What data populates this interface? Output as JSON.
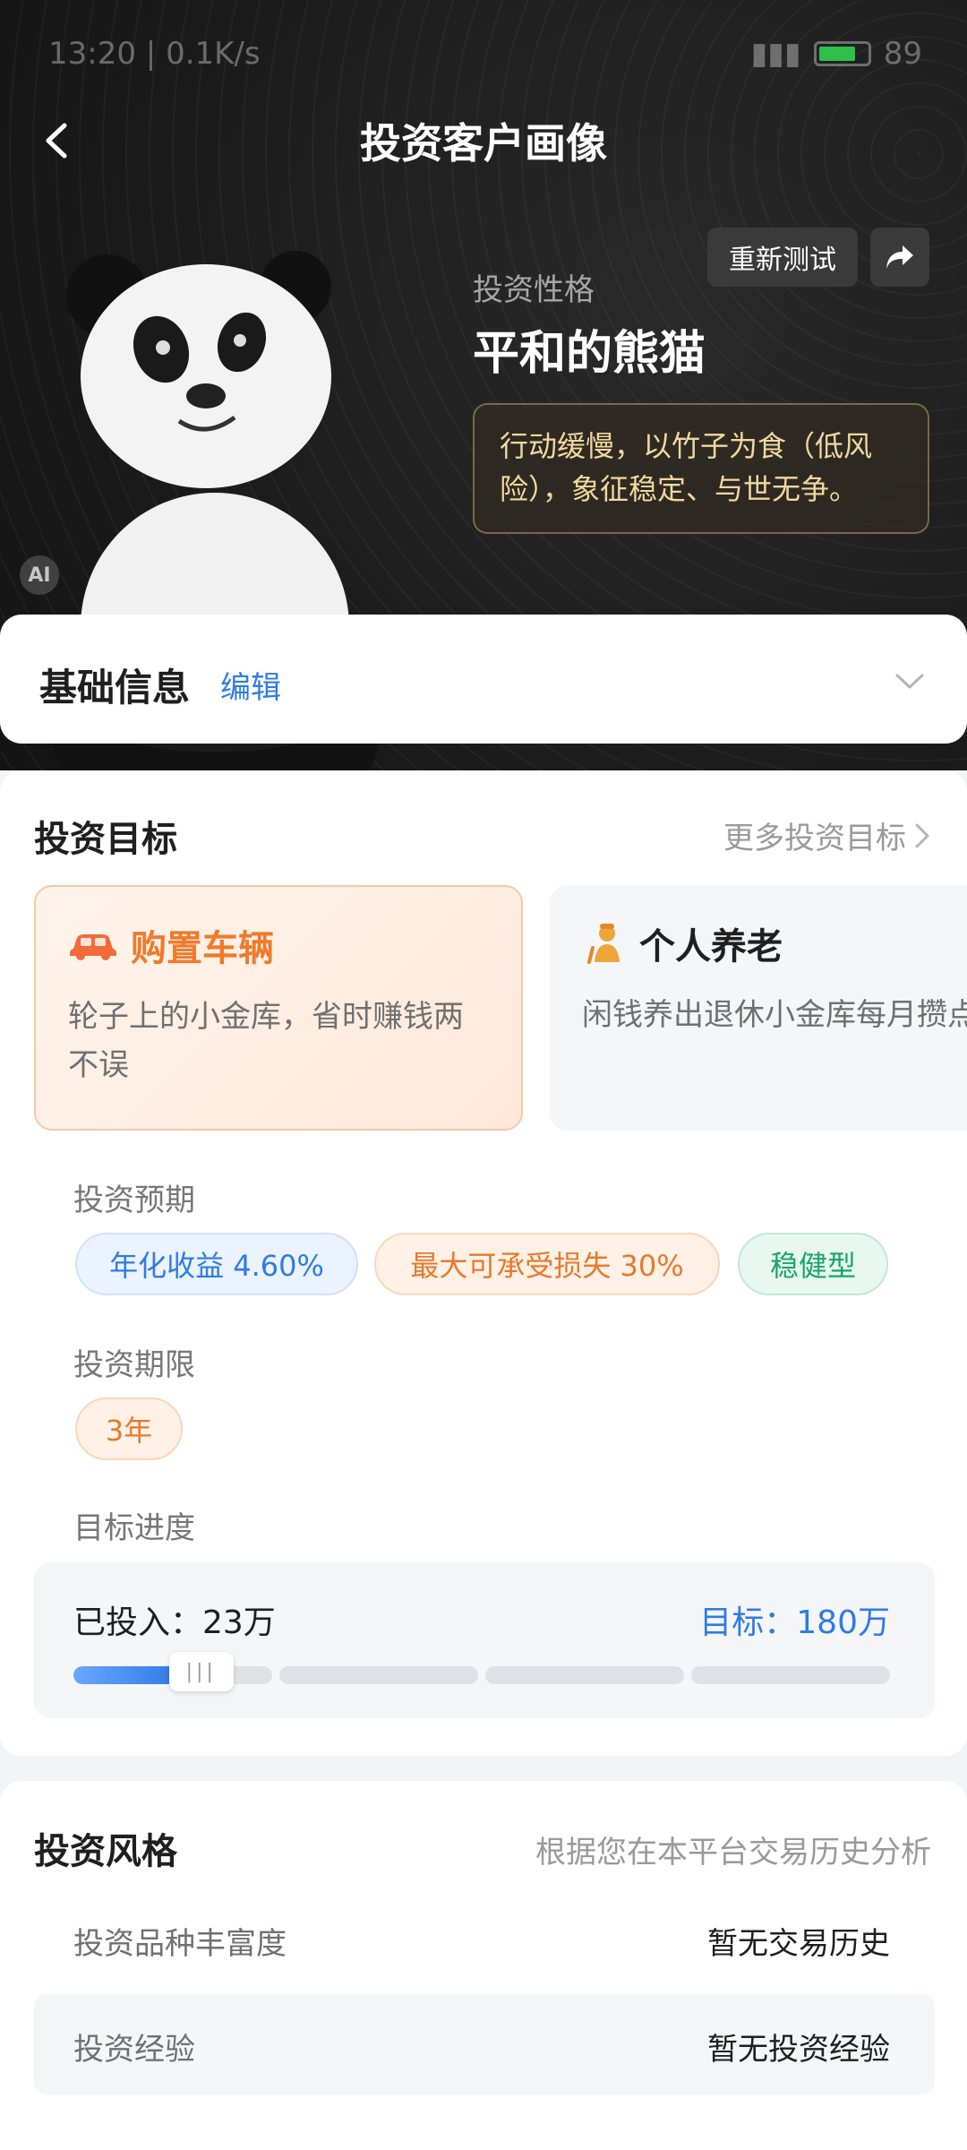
{
  "status_bar": {
    "time": "13:20",
    "speed": "0.1K/s",
    "battery": "89"
  },
  "header": {
    "title": "投资客户画像"
  },
  "hero": {
    "retest_label": "重新测试",
    "persona_label": "投资性格",
    "persona_name": "平和的熊猫",
    "persona_description": "行动缓慢，以竹子为食（低风险），象征稳定、与世无争。",
    "ai_badge": "AI"
  },
  "basic_info": {
    "title": "基础信息",
    "edit_label": "编辑"
  },
  "goals": {
    "title": "投资目标",
    "more_label": "更多投资目标",
    "items": [
      {
        "icon": "car-icon",
        "title": "购置车辆",
        "desc": "轮子上的小金库，省时赚钱两不误"
      },
      {
        "icon": "elder-person-icon",
        "title": "个人养老",
        "desc": "闲钱养出退休小金库每月攒点小钱，让复利当你…"
      }
    ],
    "expectation_label": "投资预期",
    "tags": [
      "年化收益 4.60%",
      "最大可承受损失 30%",
      "稳健型"
    ],
    "term_label": "投资期限",
    "term_value": "3年",
    "progress_label": "目标进度",
    "invested_text": "已投入：23万",
    "target_text": "目标：180万",
    "progress_fraction": 0.128
  },
  "style": {
    "title": "投资风格",
    "note": "根据您在本平台交易历史分析",
    "rows": [
      {
        "key": "投资品种丰富度",
        "value": "暂无交易历史"
      },
      {
        "key": "投资经验",
        "value": "暂无投资经验"
      }
    ]
  },
  "colors": {
    "accent_blue": "#2f7be5",
    "accent_orange": "#f07a2c",
    "accent_green": "#1aa56a",
    "gold_text": "#f2d89f"
  }
}
